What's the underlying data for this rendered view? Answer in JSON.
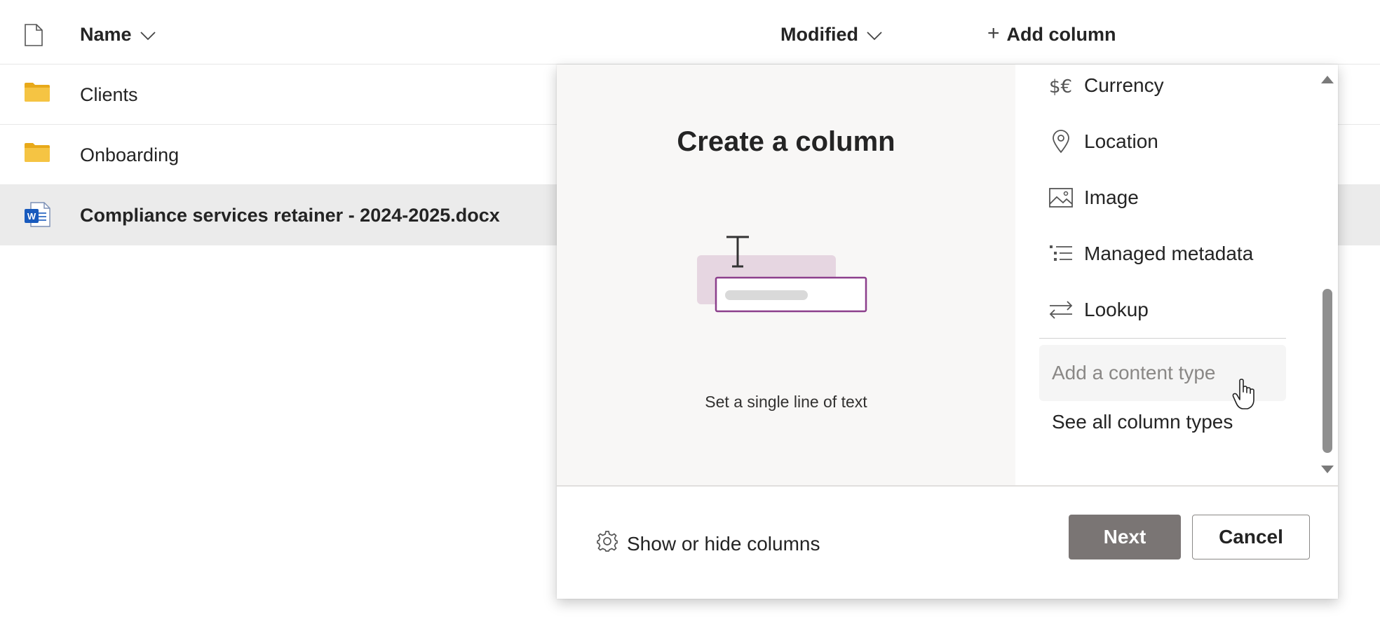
{
  "list": {
    "columns": {
      "file_type_icon": "document-icon",
      "name": "Name",
      "modified": "Modified",
      "add_column": "Add column"
    },
    "rows": [
      {
        "name": "Clients",
        "icon": "folder-icon",
        "selected": false
      },
      {
        "name": "Onboarding",
        "icon": "folder-icon",
        "selected": false
      },
      {
        "name": "Compliance services retainer - 2024-2025.docx",
        "icon": "word-document-icon",
        "selected": true
      }
    ]
  },
  "create_column_panel": {
    "title": "Create a column",
    "preview_description": "Set a single line of text",
    "column_types": [
      {
        "label": "Currency",
        "icon": "currency-icon"
      },
      {
        "label": "Location",
        "icon": "location-pin-icon"
      },
      {
        "label": "Image",
        "icon": "image-icon"
      },
      {
        "label": "Managed metadata",
        "icon": "managed-metadata-icon"
      },
      {
        "label": "Lookup",
        "icon": "lookup-arrows-icon"
      }
    ],
    "content_type_label": "Add a content type",
    "see_all_label": "See all column types",
    "footer": {
      "show_hide_label": "Show or hide columns",
      "next_label": "Next",
      "cancel_label": "Cancel"
    }
  },
  "colors": {
    "selected_row_bg": "#ebebeb",
    "next_button_bg": "#7a7574",
    "folder_yellow": "#f5c443",
    "word_blue": "#185abd",
    "illustration_purple": "#8c3f8c"
  }
}
